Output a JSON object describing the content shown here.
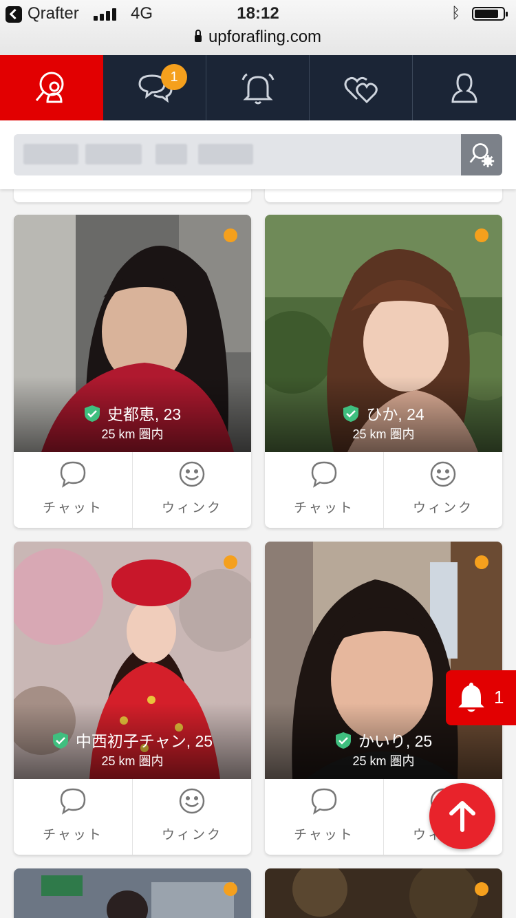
{
  "status_bar": {
    "carrier": "Qrafter",
    "network": "4G",
    "time": "18:12",
    "url": "upforafling.com"
  },
  "nav": {
    "items": [
      {
        "name": "search",
        "icon": "search-people-icon",
        "active": true
      },
      {
        "name": "messages",
        "icon": "chat-bubbles-icon",
        "badge": "1"
      },
      {
        "name": "notifications",
        "icon": "bell-icon"
      },
      {
        "name": "favorites",
        "icon": "hearts-icon"
      },
      {
        "name": "profile",
        "icon": "user-icon"
      }
    ],
    "messages_badge": "1"
  },
  "search": {
    "button_icon": "search-settings-icon"
  },
  "profiles": [
    {
      "name_age": "史都恵, 23",
      "distance": "25 km 圏内",
      "online": true,
      "verified": true
    },
    {
      "name_age": "ひか, 24",
      "distance": "25 km 圏内",
      "online": true,
      "verified": true
    },
    {
      "name_age": "中西初子チャン, 25",
      "distance": "25 km 圏内",
      "online": true,
      "verified": true
    },
    {
      "name_age": "かいり, 25",
      "distance": "25 km 圏内",
      "online": true,
      "verified": true
    }
  ],
  "actions": {
    "chat_label": "チャット",
    "wink_label": "ウィンク"
  },
  "floating": {
    "notification_count": "1"
  },
  "colors": {
    "brand_red": "#e20001",
    "nav_dark": "#1b2536",
    "badge_orange": "#f5a01d",
    "verified_green": "#3fbf7f"
  }
}
